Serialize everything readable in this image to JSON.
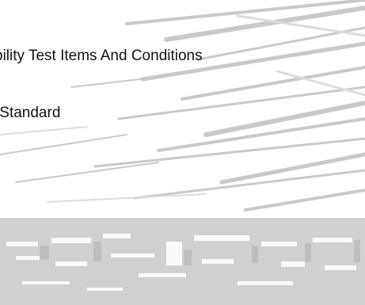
{
  "document": {
    "heading": "bility Test Items And Conditions",
    "standard_label": ".Standard"
  },
  "colors": {
    "background": "#ffffff",
    "text": "#111111",
    "band": "#d0d0d0",
    "streak": "#c8c8c8"
  }
}
